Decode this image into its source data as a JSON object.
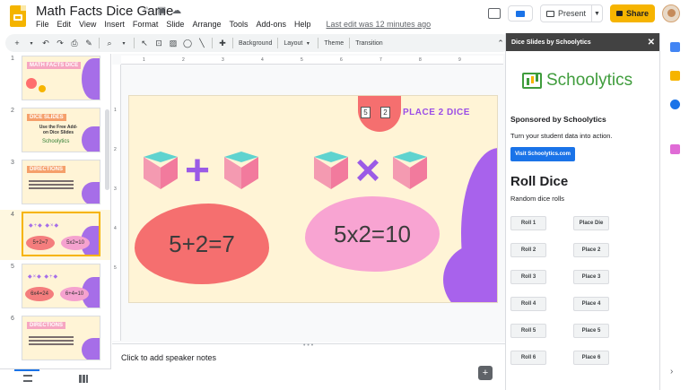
{
  "doc": {
    "title": "Math Facts Dice Game",
    "last_edit": "Last edit was 12 minutes ago"
  },
  "menu": [
    "File",
    "Edit",
    "View",
    "Insert",
    "Format",
    "Slide",
    "Arrange",
    "Tools",
    "Add-ons",
    "Help"
  ],
  "header_buttons": {
    "present": "Present",
    "share": "Share"
  },
  "toolbar": {
    "background": "Background",
    "layout": "Layout",
    "theme": "Theme",
    "transition": "Transition"
  },
  "filmstrip": {
    "slides": [
      {
        "num": "1",
        "tag": "MATH FACTS DICE"
      },
      {
        "num": "2",
        "tag": "DICE SLIDES",
        "sub": "Use the Free Add-on Dice Slides",
        "logo": "Schoolytics"
      },
      {
        "num": "3",
        "tag": "DIRECTIONS"
      },
      {
        "num": "4",
        "left": "5+2=7",
        "right": "5x2=10"
      },
      {
        "num": "5",
        "left": "6x4=24",
        "right": "6+4=10"
      },
      {
        "num": "6",
        "tag": "DIRECTIONS"
      }
    ]
  },
  "ruler": {
    "top": [
      "1",
      "2",
      "3",
      "4",
      "5",
      "6",
      "7",
      "8",
      "9"
    ],
    "left": [
      "1",
      "2",
      "3",
      "4",
      "5"
    ]
  },
  "slide": {
    "dice": [
      "5",
      "2"
    ],
    "place_label": "PLACE 2 DICE",
    "op_plus": "+",
    "op_times": "×",
    "equation_left": "5+2=7",
    "equation_right": "5x2=10"
  },
  "notes": {
    "placeholder": "Click to add speaker notes"
  },
  "side_panel": {
    "title": "Dice Slides by Schoolytics",
    "brand": "Schoolytics",
    "sponsor": "Sponsored by Schoolytics",
    "tagline": "Turn your student data into action.",
    "visit": "Visit Schoolytics.com",
    "roll_title": "Roll Dice",
    "roll_sub": "Random dice rolls",
    "buttons_left": [
      "Roll 1",
      "Roll 2",
      "Roll 3",
      "Roll 4",
      "Roll 5",
      "Roll 6"
    ],
    "buttons_right": [
      "Place Die",
      "Place 2",
      "Place 3",
      "Place 4",
      "Place 5",
      "Place 6"
    ]
  },
  "colors": {
    "accent_yellow": "#f6b400",
    "purple": "#a862ec",
    "coral": "#f56f6f",
    "pink": "#f8a4d2",
    "teal": "#5fd3cf",
    "brand_green": "#3f9c3c",
    "link_blue": "#1a73e8"
  }
}
